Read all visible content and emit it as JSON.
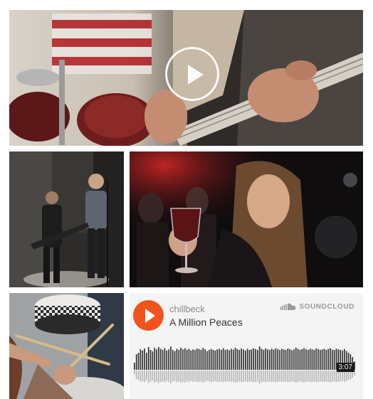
{
  "hero": {
    "play_icon": "play-icon"
  },
  "player": {
    "artist": "chillbeck",
    "track_title": "A Million Peaces",
    "brand": "SOUNDCLOUD",
    "brand_icon": "soundcloud-cloud-icon",
    "duration": "3:07",
    "play_icon": "play-icon",
    "accent_color": "#f2521c"
  },
  "waveform_levels": [
    0.25,
    0.55,
    0.6,
    0.72,
    0.68,
    0.75,
    0.6,
    0.8,
    0.7,
    0.65,
    0.78,
    0.72,
    0.8,
    0.74,
    0.7,
    0.76,
    0.68,
    0.72,
    0.82,
    0.7,
    0.66,
    0.74,
    0.7,
    0.78,
    0.72,
    0.76,
    0.7,
    0.74,
    0.68,
    0.72,
    0.7,
    0.75,
    0.73,
    0.7,
    0.77,
    0.72,
    0.66,
    0.7,
    0.74,
    0.7,
    0.68,
    0.72,
    0.74,
    0.7,
    0.76,
    0.7,
    0.72,
    0.69,
    0.74,
    0.71,
    0.78,
    0.73,
    0.7,
    0.75,
    0.72,
    0.68,
    0.74,
    0.7,
    0.72,
    0.76,
    0.73,
    0.7,
    0.82,
    0.74,
    0.7,
    0.76,
    0.72,
    0.7,
    0.74,
    0.71,
    0.76,
    0.73,
    0.7,
    0.74,
    0.72,
    0.7,
    0.75,
    0.73,
    0.69,
    0.72,
    0.78,
    0.74,
    0.7,
    0.73,
    0.76,
    0.72,
    0.7,
    0.74,
    0.72,
    0.7,
    0.75,
    0.73,
    0.7,
    0.72,
    0.74,
    0.7,
    0.73,
    0.76,
    0.71,
    0.7,
    0.74,
    0.72,
    0.7,
    0.68,
    0.73,
    0.66,
    0.6,
    0.55,
    0.45,
    0.3
  ]
}
